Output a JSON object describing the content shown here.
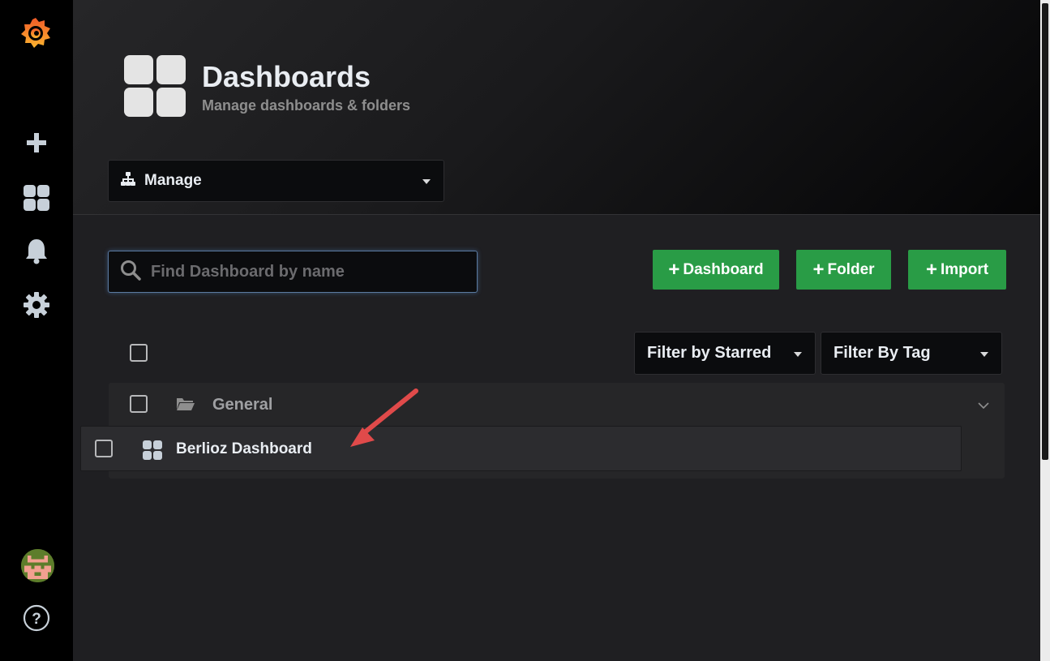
{
  "sidebar": {
    "items": [
      {
        "name": "create",
        "icon": "plus-icon"
      },
      {
        "name": "dashboards",
        "icon": "dashboards-icon"
      },
      {
        "name": "alerting",
        "icon": "bell-icon"
      },
      {
        "name": "configuration",
        "icon": "gear-icon"
      }
    ],
    "avatar_icon": "user-avatar",
    "help_icon": "help-icon"
  },
  "header": {
    "title": "Dashboards",
    "subtitle": "Manage dashboards & folders",
    "nav_select": "Manage"
  },
  "search": {
    "placeholder": "Find Dashboard by name",
    "value": ""
  },
  "actions": {
    "dashboard_label": "Dashboard",
    "folder_label": "Folder",
    "import_label": "Import"
  },
  "filters": {
    "starred_label": "Filter by Starred",
    "tag_label": "Filter By Tag"
  },
  "list": {
    "folder": "General",
    "dashboards": [
      "Berlioz Dashboard"
    ]
  },
  "colors": {
    "accent_green": "#299c46",
    "annotation_arrow": "#e04a4a",
    "brand_orange": "#f46800"
  }
}
